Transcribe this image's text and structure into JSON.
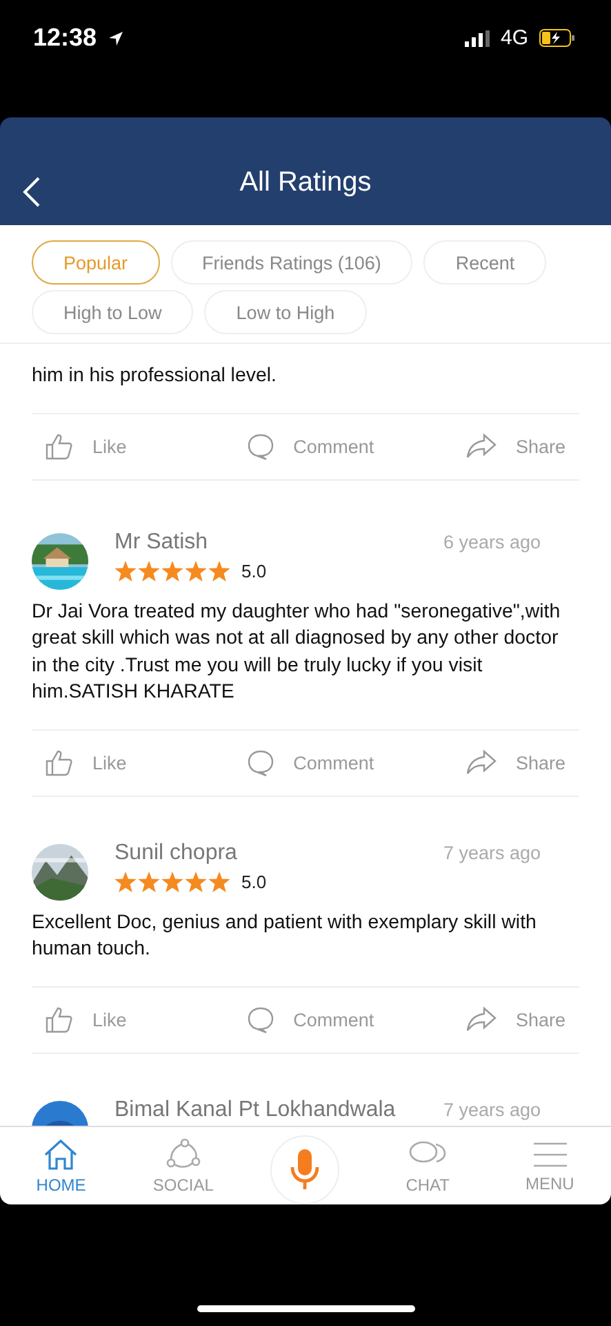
{
  "status_bar": {
    "time": "12:38",
    "network": "4G"
  },
  "header": {
    "title": "All Ratings"
  },
  "filters": [
    {
      "label": "Popular",
      "selected": true
    },
    {
      "label": "Friends Ratings (106)",
      "selected": false
    },
    {
      "label": "Recent",
      "selected": false
    },
    {
      "label": "High to Low",
      "selected": false
    },
    {
      "label": "Low to High",
      "selected": false
    }
  ],
  "reviews": [
    {
      "kind": "partial",
      "text": "him in his professional level.",
      "actions": [
        {
          "kind": "like",
          "label": "Like"
        },
        {
          "kind": "comment",
          "label": "Comment"
        },
        {
          "kind": "share",
          "label": "Share"
        }
      ]
    },
    {
      "kind": "full",
      "avatar": {
        "kind": "picture"
      },
      "name": "Mr Satish",
      "time": "6 years ago",
      "stars": 5,
      "rating": "5.0",
      "text": "Dr Jai Vora treated my daughter who had \"seronegative\",with great skill which was not at all diagnosed by any other doctor in the city .Trust me you will be truly lucky if you visit him.SATISH KHARATE",
      "actions": [
        {
          "kind": "like",
          "label": "Like"
        },
        {
          "kind": "comment",
          "label": "Comment"
        },
        {
          "kind": "share",
          "label": "Share"
        }
      ]
    },
    {
      "kind": "full",
      "avatar": {
        "kind": "picture"
      },
      "name": "Sunil chopra",
      "time": "7 years ago",
      "stars": 5,
      "rating": "5.0",
      "text": "Excellent Doc, genius and patient with exemplary skill with human touch.",
      "actions": [
        {
          "kind": "like",
          "label": "Like"
        },
        {
          "kind": "comment",
          "label": "Comment"
        },
        {
          "kind": "share",
          "label": "Share"
        }
      ]
    },
    {
      "kind": "cut",
      "avatar": {
        "kind": "picture"
      },
      "name": "Bimal Kanal Pt Lokhandwala",
      "time": "7 years ago"
    }
  ],
  "nav": [
    {
      "kind": "home",
      "label": "HOME",
      "selected": true
    },
    {
      "kind": "social",
      "label": "SOCIAL",
      "selected": false
    },
    {
      "kind": "mic"
    },
    {
      "kind": "chat",
      "label": "CHAT",
      "selected": false
    },
    {
      "kind": "menu",
      "label": "MENU",
      "selected": false
    }
  ]
}
